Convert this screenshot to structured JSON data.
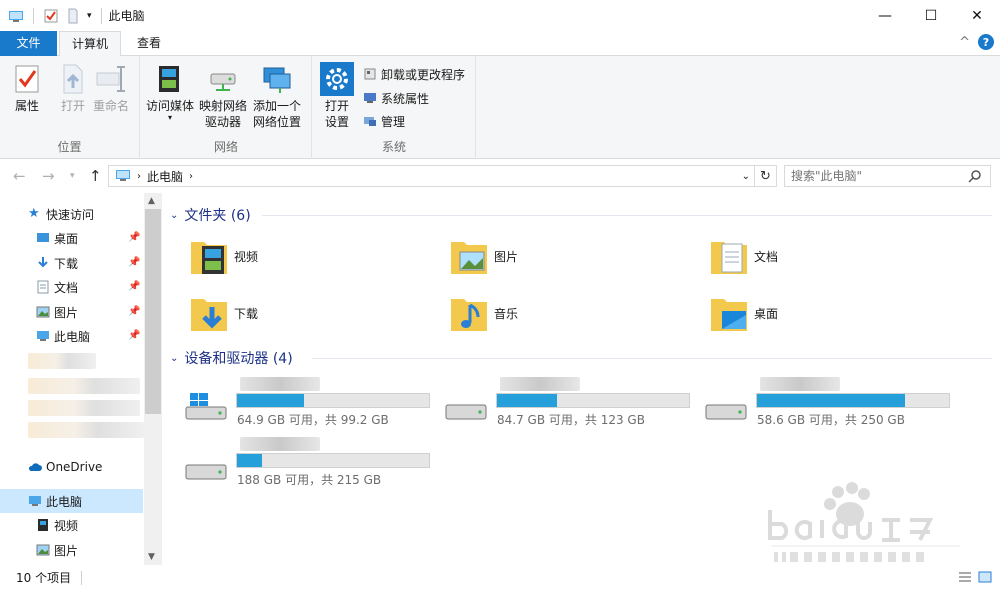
{
  "window": {
    "title": "此电脑",
    "minimize": "—",
    "maximize": "☐",
    "close": "✕"
  },
  "ribbon_tabs": {
    "file": "文件",
    "computer": "计算机",
    "view": "查看",
    "collapse": "^",
    "help": "?"
  },
  "ribbon": {
    "location": {
      "label": "位置",
      "properties": "属性",
      "open": "打开",
      "rename": "重命名"
    },
    "network": {
      "label": "网络",
      "access_media": "访问媒体",
      "map_drive_1": "映射网络",
      "map_drive_2": "驱动器",
      "add_location_1": "添加一个",
      "add_location_2": "网络位置"
    },
    "system": {
      "label": "系统",
      "open_settings_1": "打开",
      "open_settings_2": "设置",
      "uninstall": "卸载或更改程序",
      "system_properties": "系统属性",
      "manage": "管理"
    }
  },
  "address": {
    "path": "此电脑",
    "search_placeholder": "搜索\"此电脑\""
  },
  "nav": {
    "quick_access": "快速访问",
    "quick_items": [
      {
        "label": "桌面"
      },
      {
        "label": "下载"
      },
      {
        "label": "文档"
      },
      {
        "label": "图片"
      },
      {
        "label": "此电脑"
      }
    ],
    "onedrive": "OneDrive",
    "this_pc": "此电脑",
    "pc_items": [
      {
        "label": "视频"
      },
      {
        "label": "图片"
      }
    ]
  },
  "content": {
    "folders_header": "文件夹 (6)",
    "folders": [
      {
        "label": "视频",
        "icon": "video-folder-icon"
      },
      {
        "label": "图片",
        "icon": "pictures-folder-icon"
      },
      {
        "label": "文档",
        "icon": "documents-folder-icon"
      },
      {
        "label": "下载",
        "icon": "downloads-folder-icon"
      },
      {
        "label": "音乐",
        "icon": "music-folder-icon"
      },
      {
        "label": "桌面",
        "icon": "desktop-folder-icon"
      }
    ],
    "devices_header": "设备和驱动器 (4)",
    "drives": [
      {
        "text": "64.9 GB 可用，共 99.2 GB",
        "used_fraction": 0.35,
        "icon": "windows-drive-icon"
      },
      {
        "text": "84.7 GB 可用，共 123 GB",
        "used_fraction": 0.31,
        "icon": "drive-icon"
      },
      {
        "text": "58.6 GB 可用，共 250 GB",
        "used_fraction": 0.77,
        "icon": "drive-icon"
      },
      {
        "text": "188 GB 可用，共 215 GB",
        "used_fraction": 0.13,
        "icon": "drive-icon"
      }
    ]
  },
  "status": {
    "count": "10 个项目"
  },
  "colors": {
    "accent": "#1979ca",
    "header_text": "#1e3287",
    "drive_fill": "#26a0da",
    "folder": "#f3c94d"
  }
}
